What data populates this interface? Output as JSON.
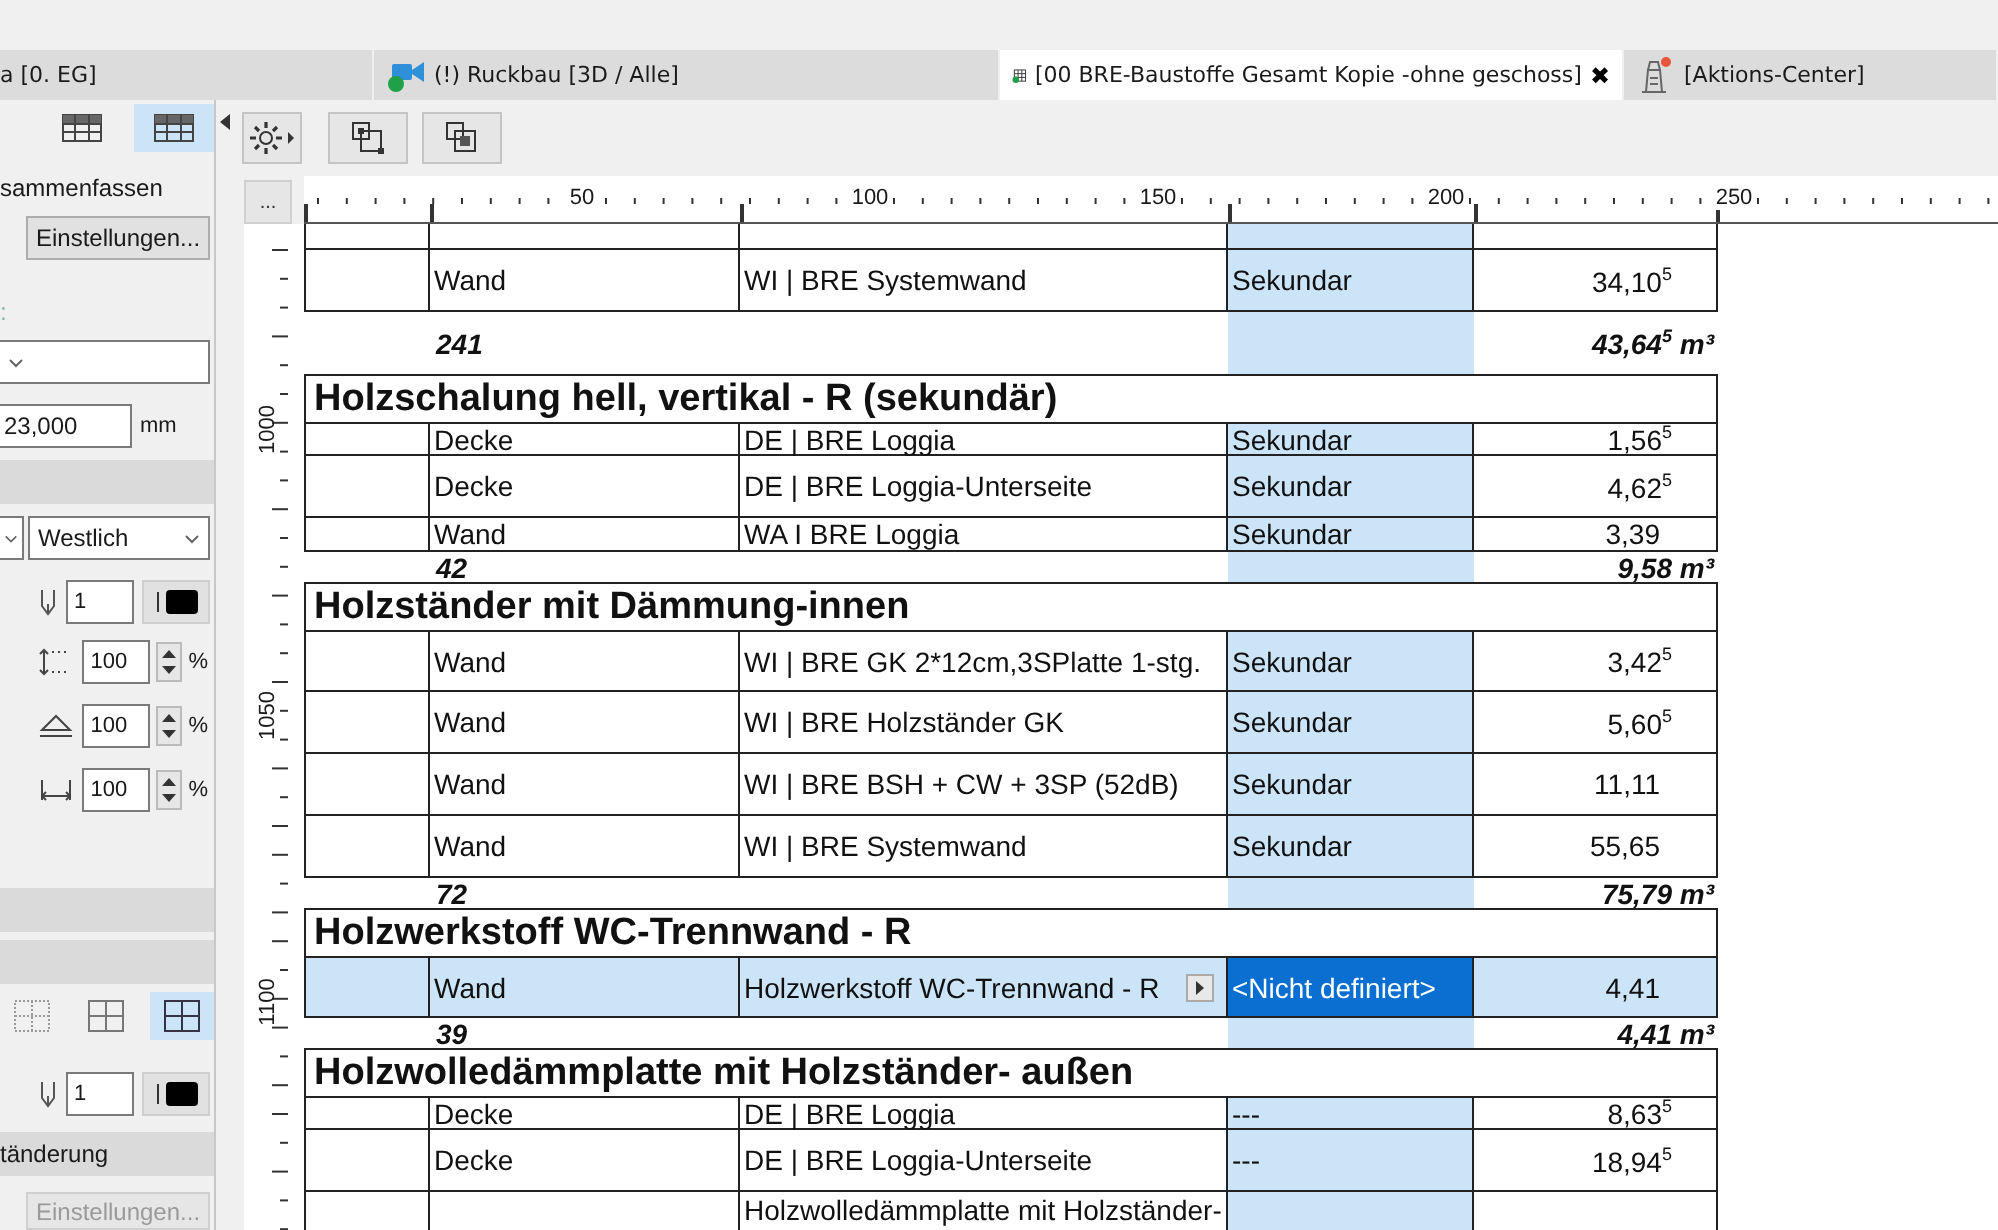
{
  "tabs": [
    {
      "label": "a [0. EG]",
      "selected": false,
      "kind": "plan"
    },
    {
      "label": "(!) Ruckbau [3D / Alle]",
      "selected": false,
      "kind": "camera"
    },
    {
      "label": "[00 BRE-Baustoffe Gesamt Kopie -ohne geschoss]",
      "selected": true,
      "kind": "schedule",
      "close": "✖"
    },
    {
      "label": "[Aktions-Center]",
      "selected": false,
      "kind": "action"
    }
  ],
  "left_panel": [
    {
      "kind": "view_toggle",
      "options": [
        {
          "selected": false
        },
        {
          "selected": true
        }
      ]
    },
    {
      "kind": "label",
      "text": "sammenfassen"
    },
    {
      "kind": "button",
      "label": "Einstellungen...",
      "disabled": false
    },
    {
      "kind": "label",
      "text": ":"
    },
    {
      "kind": "dropdown"
    },
    {
      "kind": "number_field",
      "value": "23,000",
      "unit": "mm"
    },
    {
      "kind": "section_bar"
    },
    {
      "kind": "dropdown_pair",
      "value": "Westlich"
    },
    {
      "kind": "pen_row",
      "value": "1"
    },
    {
      "kind": "scale_row",
      "value": "100",
      "unit": "%"
    },
    {
      "kind": "scale_row",
      "value": "100",
      "unit": "%"
    },
    {
      "kind": "scale_row",
      "value": "100",
      "unit": "%"
    },
    {
      "kind": "section_bar"
    },
    {
      "kind": "section_bar"
    },
    {
      "kind": "grid_options",
      "options": [
        {
          "selected": false
        },
        {
          "selected": false
        },
        {
          "selected": true
        }
      ]
    },
    {
      "kind": "pen_row",
      "value": "1"
    },
    {
      "kind": "section_bar",
      "label": "tänderung"
    },
    {
      "kind": "button",
      "label": "Einstellungen...",
      "disabled": true
    }
  ],
  "toolbar": [
    {
      "kind": "gear_menu"
    },
    {
      "kind": "fit"
    },
    {
      "kind": "layers"
    }
  ],
  "ruler": {
    "more_button": "...",
    "labels": [
      "50",
      "100",
      "150",
      "200",
      "250"
    ],
    "vertical_labels": [
      "1000",
      "1050",
      "1100"
    ]
  },
  "schedule": {
    "rows": [
      {
        "kind": "row",
        "compact": false,
        "selected": false,
        "cells": [
          "Wand",
          "WI | BRE Systemwand",
          "Sekundar",
          "34,10$^{5}$"
        ]
      },
      {
        "kind": "sum",
        "compact": false,
        "count": "241",
        "total": "43,64$^{5}$ m³"
      },
      {
        "kind": "header",
        "title": "Holzschalung hell, vertikal - R (sekundär)"
      },
      {
        "kind": "row",
        "compact": true,
        "selected": false,
        "cells": [
          "Decke",
          "DE | BRE Loggia",
          "Sekundar",
          "1,56$^{5}$"
        ]
      },
      {
        "kind": "row",
        "compact": false,
        "selected": false,
        "cells": [
          "Decke",
          "DE | BRE Loggia-Unterseite",
          "Sekundar",
          "4,62$^{5}$"
        ]
      },
      {
        "kind": "row",
        "compact": true,
        "selected": false,
        "cells": [
          "Wand",
          "WA I BRE Loggia",
          "Sekundar",
          "3,39"
        ]
      },
      {
        "kind": "sum",
        "compact": true,
        "count": "42",
        "total": "9,58 m³"
      },
      {
        "kind": "header",
        "title": "Holzständer mit Dämmung-innen"
      },
      {
        "kind": "row",
        "compact": false,
        "selected": false,
        "cells": [
          "Wand",
          "WI | BRE GK 2*12cm,3SPlatte 1-stg.",
          "Sekundar",
          "3,42$^{5}$"
        ]
      },
      {
        "kind": "row",
        "compact": false,
        "selected": false,
        "cells": [
          "Wand",
          "WI | BRE Holzständer GK",
          "Sekundar",
          "5,60$^{5}$"
        ]
      },
      {
        "kind": "row",
        "compact": false,
        "selected": false,
        "cells": [
          "Wand",
          "WI | BRE BSH + CW + 3SP (52dB)",
          "Sekundar",
          "11,11"
        ]
      },
      {
        "kind": "row",
        "compact": false,
        "selected": false,
        "cells": [
          "Wand",
          "WI | BRE Systemwand",
          "Sekundar",
          "55,65"
        ]
      },
      {
        "kind": "sum",
        "compact": true,
        "count": "72",
        "total": "75,79 m³"
      },
      {
        "kind": "header",
        "title": "Holzwerkstoff WC-Trennwand - R"
      },
      {
        "kind": "row",
        "compact": false,
        "selected": true,
        "cells": [
          "Wand",
          "Holzwerkstoff WC-Trennwand - R",
          "<Nicht definiert>",
          "4,41"
        ]
      },
      {
        "kind": "sum",
        "compact": true,
        "count": "39",
        "total": "4,41 m³"
      },
      {
        "kind": "header",
        "title": "Holzwolledämmplatte mit Holzständer- außen"
      },
      {
        "kind": "row",
        "compact": true,
        "selected": false,
        "cells": [
          "Decke",
          "DE | BRE Loggia",
          "---",
          "8,63$^{5}$"
        ]
      },
      {
        "kind": "row",
        "compact": false,
        "selected": false,
        "cells": [
          "Decke",
          "DE | BRE Loggia-Unterseite",
          "---",
          "18,94$^{5}$"
        ]
      },
      {
        "kind": "row",
        "compact": false,
        "selected": false,
        "cells": [
          null,
          "Holzwolledämmplatte mit Holzständer-",
          null,
          null
        ]
      }
    ]
  }
}
